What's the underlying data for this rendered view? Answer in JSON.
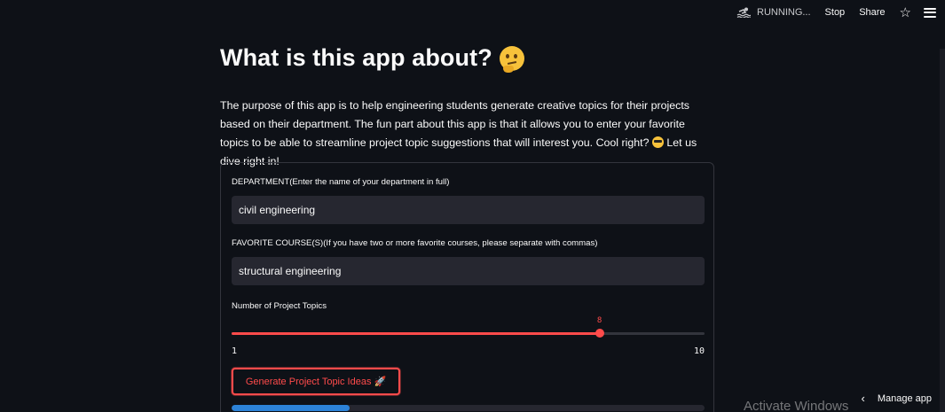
{
  "toolbar": {
    "running_label": "RUNNING...",
    "stop_label": "Stop",
    "share_label": "Share"
  },
  "page": {
    "title": "What is this app about?",
    "description_part1": "The purpose of this app is to help engineering students generate creative topics for their projects based on their department. The fun part about this app is that it allows you to enter your favorite topics to be able to streamline project topic suggestions that will interest you. Cool right?",
    "description_part2": " Let us dive right in!"
  },
  "form": {
    "department_label": "DEPARTMENT(Enter the name of your department in full)",
    "department_value": "civil engineering",
    "course_label": "FAVORITE COURSE(S)(If you have two or more favorite courses, please separate with commas)",
    "course_value": "structural engineering",
    "slider_label": "Number of Project Topics",
    "slider_value": "8",
    "slider_min": "1",
    "slider_max": "10",
    "generate_label": "Generate Project Topic Ideas",
    "progress_fraction": 0.25
  },
  "footer": {
    "activate_text": "Activate Windows",
    "manage_label": "Manage app"
  },
  "colors": {
    "accent": "#ff4b4b",
    "progress": "#2c82d7",
    "background": "#0e1117",
    "input_bg": "#262730"
  },
  "icons": [
    "running-swimmer-icon",
    "star-icon",
    "hamburger-menu-icon",
    "thinking-face-icon",
    "sunglasses-face-icon",
    "rocket-icon",
    "chevron-left-icon"
  ]
}
